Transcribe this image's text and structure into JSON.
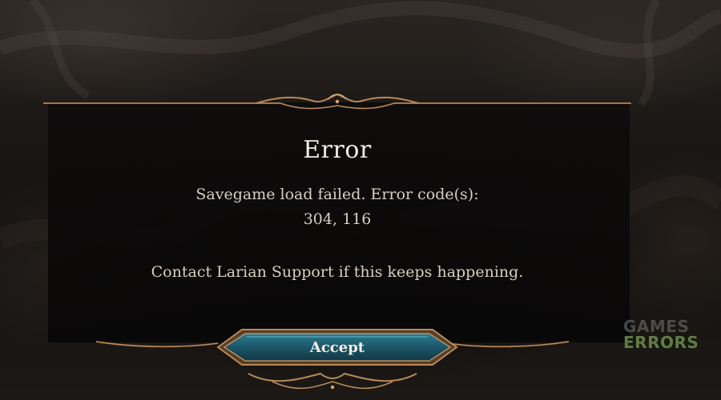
{
  "dialog": {
    "title": "Error",
    "message_line1": "Savegame load failed. Error code(s):",
    "message_line2": "304, 116",
    "message_line3": "Contact Larian Support if this keeps happening.",
    "accept_label": "Accept"
  },
  "watermark": {
    "line1": "GAMES",
    "line2": "ERRORS"
  },
  "colors": {
    "ornament_gold": "#a7794d",
    "button_teal": "#1f5f70",
    "text_primary": "#f3ede2",
    "text_secondary": "#d9cfbf"
  }
}
